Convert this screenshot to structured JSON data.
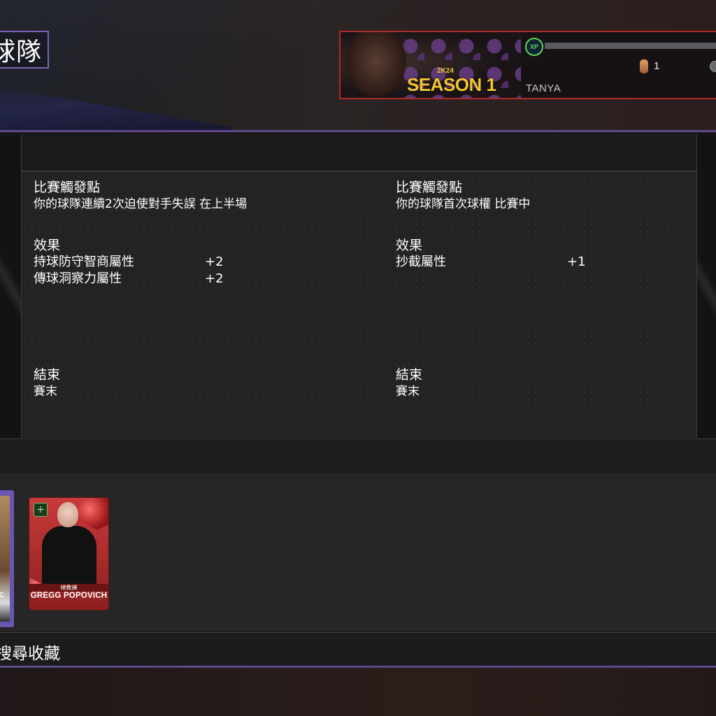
{
  "header": {
    "title": "球隊"
  },
  "season_banner": {
    "brand": "2K24",
    "season": "SEASON 1",
    "player_name": "TANYA",
    "xp_label": "XP",
    "xp_progress": 0.0,
    "coin_count": "1"
  },
  "columns": [
    {
      "trigger_heading": "比賽觸發點",
      "trigger_text": "你的球隊連續2次迫使對手失誤 在上半場",
      "effect_heading": "效果",
      "effects": [
        {
          "name": "持球防守智商屬性",
          "value": "+2"
        },
        {
          "name": "傳球洞察力屬性",
          "value": "+2"
        }
      ],
      "end_heading": "結束",
      "end_text": "賽末"
    },
    {
      "trigger_heading": "比賽觸發點",
      "trigger_text": "你的球隊首次球權 比賽中",
      "effect_heading": "效果",
      "effects": [
        {
          "name": "抄截屬性",
          "value": "+1"
        }
      ],
      "end_heading": "結束",
      "end_text": "賽末"
    }
  ],
  "cards": {
    "prev_card_text": "IC",
    "card": {
      "role": "總教練",
      "name": "GREGG POPOVICH",
      "badge_icon": "plus-icon"
    }
  },
  "bottom_bar": {
    "search_label": "搜尋收藏"
  },
  "colors": {
    "accent_purple": "#7a63b8",
    "season_gold": "#f4c531",
    "card_red": "#c83a3a",
    "xp_green": "#5fd35f"
  }
}
